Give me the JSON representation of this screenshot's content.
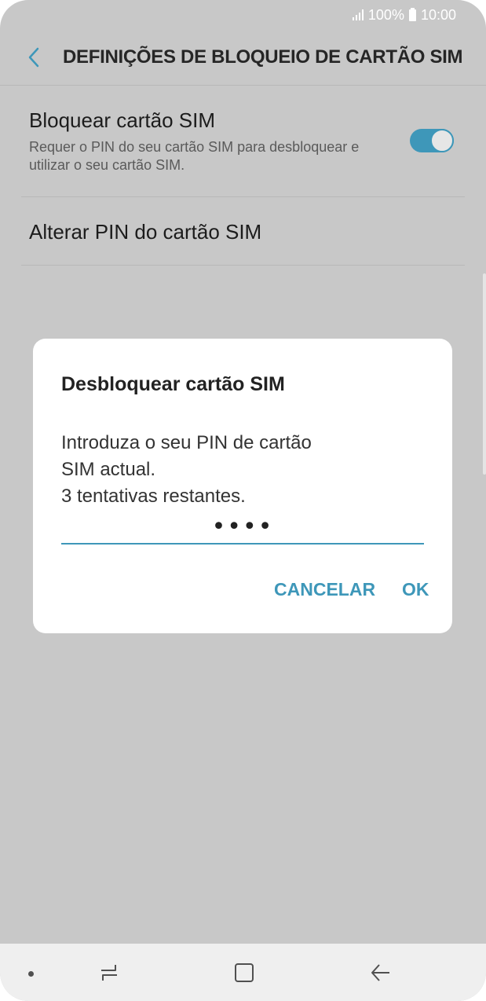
{
  "status_bar": {
    "battery": "100%",
    "time": "10:00"
  },
  "header": {
    "title": "DEFINIÇÕES DE BLOQUEIO DE CARTÃO SIM",
    "back_icon": "chevron-left-icon"
  },
  "settings": {
    "lock_sim": {
      "title": "Bloquear cartão SIM",
      "description": "Requer o PIN do seu cartão SIM para desbloquear e utilizar o seu cartão SIM.",
      "toggle_on": true
    },
    "change_pin": {
      "title": "Alterar PIN do cartão SIM"
    }
  },
  "dialog": {
    "title": "Desbloquear cartão SIM",
    "message_line1": "Introduza o seu PIN de cartão",
    "message_line2": "SIM actual.",
    "message_line3": "3 tentativas restantes.",
    "pin_value": "••••",
    "cancel_label": "CANCELAR",
    "ok_label": "OK"
  },
  "colors": {
    "accent": "#3e97b9",
    "background_dim": "#c8c8c8"
  },
  "nav_bar": {
    "icons": [
      "dot-icon",
      "recent-apps-icon",
      "home-icon",
      "back-icon"
    ]
  }
}
